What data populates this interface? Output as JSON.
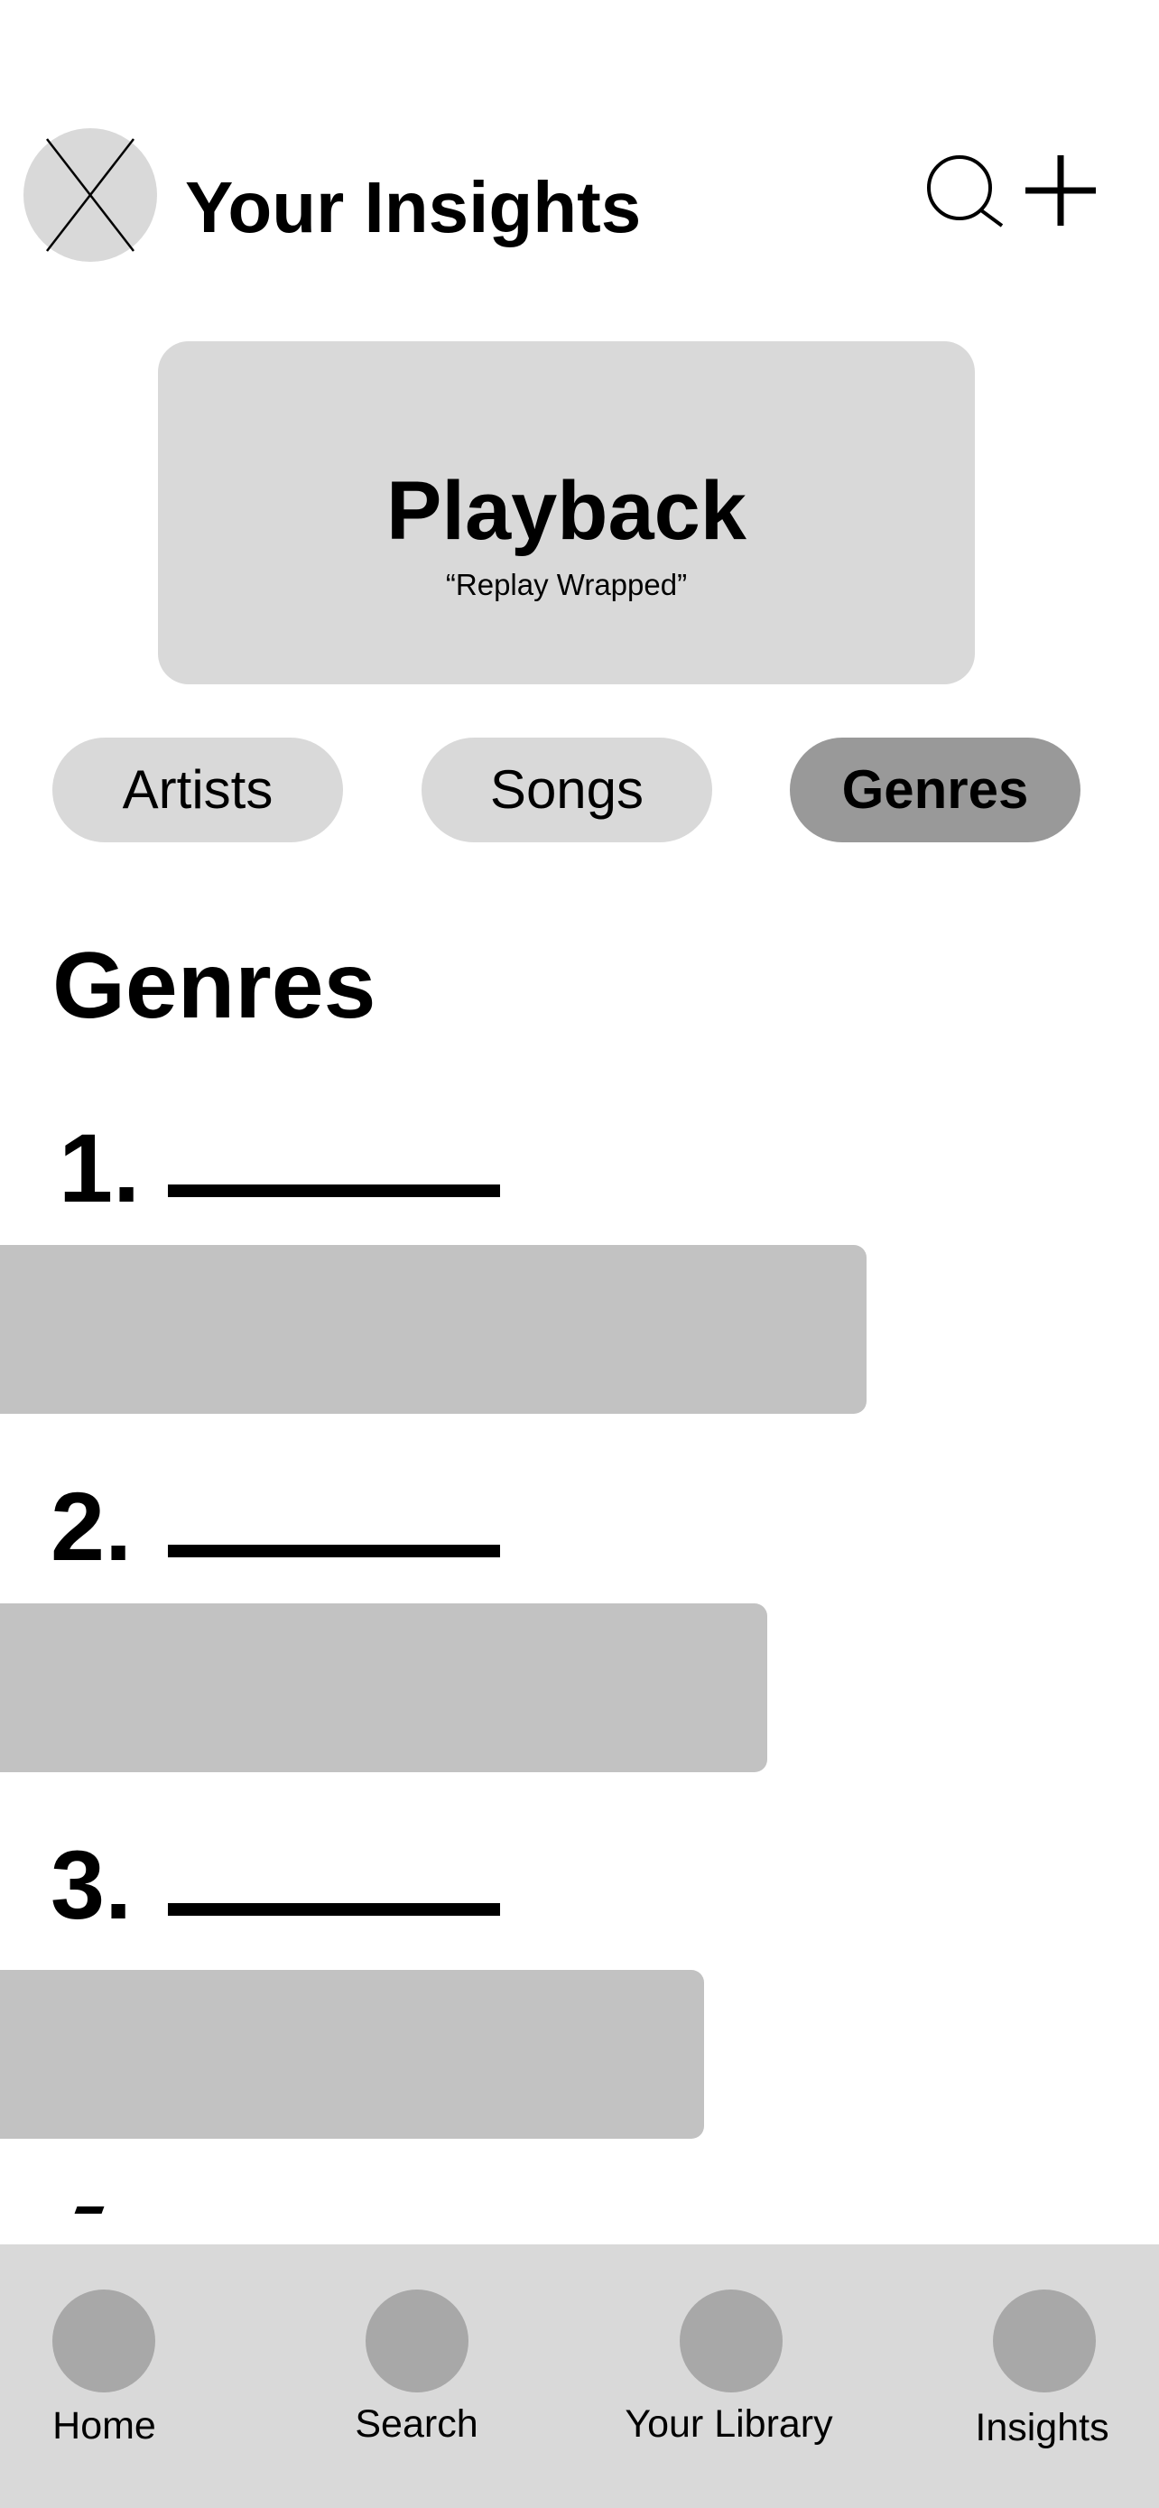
{
  "header": {
    "title": "Your Insights",
    "avatar_icon": "avatar-placeholder-icon",
    "search_icon": "search-icon",
    "add_icon": "plus-icon"
  },
  "hero": {
    "title": "Playback",
    "subtitle": "“Replay Wrapped”"
  },
  "tabs": [
    {
      "label": "Artists",
      "active": false
    },
    {
      "label": "Songs",
      "active": false
    },
    {
      "label": "Genres",
      "active": true
    }
  ],
  "section": {
    "title": "Genres"
  },
  "rankings": [
    {
      "rank": "1.",
      "relative_value": 0.96
    },
    {
      "rank": "2.",
      "relative_value": 0.85
    },
    {
      "rank": "3.",
      "relative_value": 0.78
    }
  ],
  "bottom_nav": {
    "items": [
      {
        "label": "Home"
      },
      {
        "label": "Search"
      },
      {
        "label": "Your Library"
      },
      {
        "label": "Insights"
      }
    ]
  },
  "colors": {
    "background": "#ffffff",
    "card": "#d9d9d9",
    "active_tab": "#999999",
    "bar": "#c2c2c2",
    "nav_icon": "#a8a8a8"
  }
}
